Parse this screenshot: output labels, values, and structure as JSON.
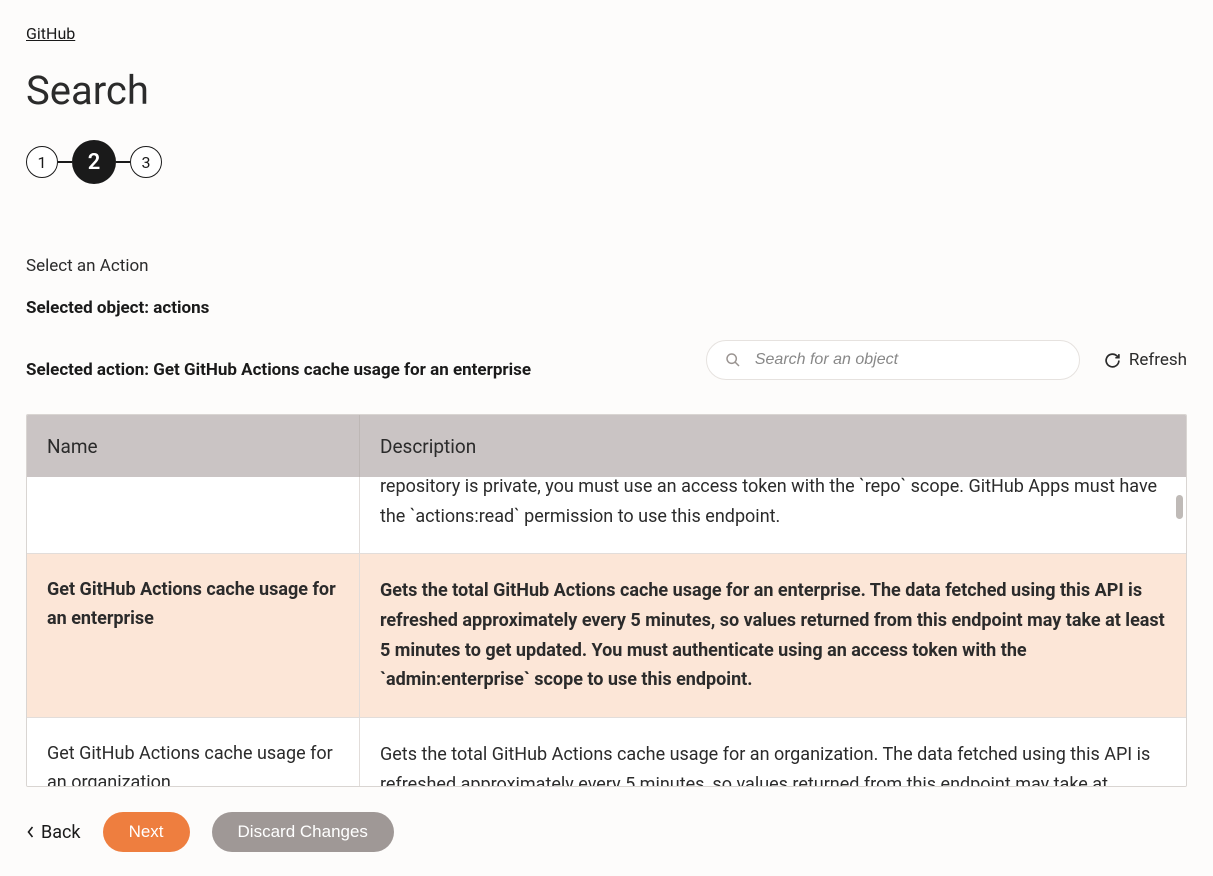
{
  "breadcrumb": {
    "label": "GitHub"
  },
  "page": {
    "title": "Search"
  },
  "stepper": {
    "steps": [
      "1",
      "2",
      "3"
    ],
    "active_index": 1
  },
  "section": {
    "label": "Select an Action"
  },
  "selected": {
    "object_line": "Selected object: actions",
    "action_line": "Selected action: Get GitHub Actions cache usage for an enterprise"
  },
  "search": {
    "placeholder": "Search for an object"
  },
  "refresh": {
    "label": "Refresh"
  },
  "table": {
    "headers": {
      "name": "Name",
      "description": "Description"
    },
    "rows": [
      {
        "name": "",
        "description": "repository is private, you must use an access token with the `repo` scope. GitHub Apps must have the `actions:read` permission to use this endpoint.",
        "selected": false,
        "partial_top": true
      },
      {
        "name": "Get GitHub Actions cache usage for an enterprise",
        "description": "Gets the total GitHub Actions cache usage for an enterprise. The data fetched using this API is refreshed approximately every 5 minutes, so values returned from this endpoint may take at least 5 minutes to get updated. You must authenticate using an access token with the `admin:enterprise` scope to use this endpoint.",
        "selected": true,
        "partial_top": false
      },
      {
        "name": "Get GitHub Actions cache usage for an organization",
        "description": "Gets the total GitHub Actions cache usage for an organization. The data fetched using this API is refreshed approximately every 5 minutes, so values returned from this endpoint may take at",
        "selected": false,
        "partial_top": false
      }
    ]
  },
  "footer": {
    "back": "Back",
    "next": "Next",
    "discard": "Discard Changes"
  }
}
